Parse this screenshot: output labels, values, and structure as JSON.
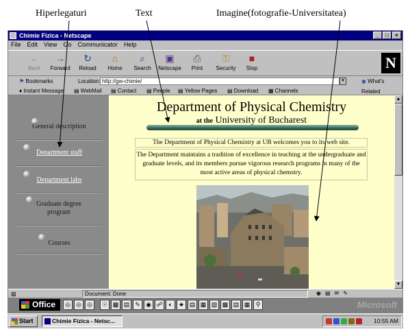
{
  "annotations": {
    "links": "Hiperlegaturi",
    "text": "Text",
    "image": "Imagine(fotografie-Universitatea)"
  },
  "window": {
    "title": "Chimie Fizica - Netscape",
    "controls": [
      "_",
      "□",
      "×"
    ]
  },
  "menu": [
    "File",
    "Edit",
    "View",
    "Go",
    "Communicator",
    "Help"
  ],
  "nav_toolbar": [
    {
      "label": "Back",
      "icon": "back-arrow-icon",
      "glyph": "←",
      "disabled": true
    },
    {
      "label": "Forward",
      "icon": "forward-arrow-icon",
      "glyph": "→",
      "disabled": false
    },
    {
      "label": "Reload",
      "icon": "reload-icon",
      "glyph": "↻",
      "disabled": false
    },
    {
      "label": "Home",
      "icon": "home-icon",
      "glyph": "⌂",
      "disabled": false
    },
    {
      "label": "Search",
      "icon": "search-icon",
      "glyph": "⌕",
      "disabled": false
    },
    {
      "label": "Netscape",
      "icon": "netscape-icon",
      "glyph": "▣",
      "disabled": false
    },
    {
      "label": "Print",
      "icon": "print-icon",
      "glyph": "⎙",
      "disabled": false
    },
    {
      "label": "Security",
      "icon": "security-lock-icon",
      "glyph": "⚿",
      "disabled": false
    },
    {
      "label": "Stop",
      "icon": "stop-icon",
      "glyph": "■",
      "disabled": false
    }
  ],
  "location_bar": {
    "bookmarks_label": "Bookmarks",
    "location_label": "Location:",
    "url": "http://gw-chimie/",
    "related_label": "What's Related"
  },
  "personal_toolbar": [
    "Instant Message",
    "WebMail",
    "Contact",
    "People",
    "Yellow Pages",
    "Download",
    "Channels"
  ],
  "sidebar": {
    "items": [
      {
        "label": "General description",
        "is_link": false
      },
      {
        "label": "Department staff",
        "is_link": true
      },
      {
        "label": "Department labs",
        "is_link": true
      },
      {
        "label": "Graduate degree program",
        "is_link": false
      },
      {
        "label": "Courses",
        "is_link": false
      }
    ]
  },
  "page": {
    "title": "Department of Physical Chemistry",
    "subtitle_prefix": "at the",
    "subtitle": "University of Bucharest",
    "welcome": "The Department of Physical  Chemistry at UB welcomes  you to its web site.",
    "description": "The Department maintains a tradition of excellence in teaching at the undergraduate and graduate levels, and its members pursue vigorous research programs in many of the most active areas of physical chemstry."
  },
  "status": {
    "text": "Document: Done"
  },
  "office_bar": {
    "label": "Office",
    "brand": "Microsoft"
  },
  "taskbar": {
    "start_label": "Start",
    "task_label": "Chimie Fizica - Netsc...",
    "clock": "10:55 AM"
  },
  "colors": {
    "title_bar": "#000080",
    "sidebar": "#8a8a8a",
    "page_bg": "#ffffcc",
    "chrome": "#c0c0c0"
  }
}
